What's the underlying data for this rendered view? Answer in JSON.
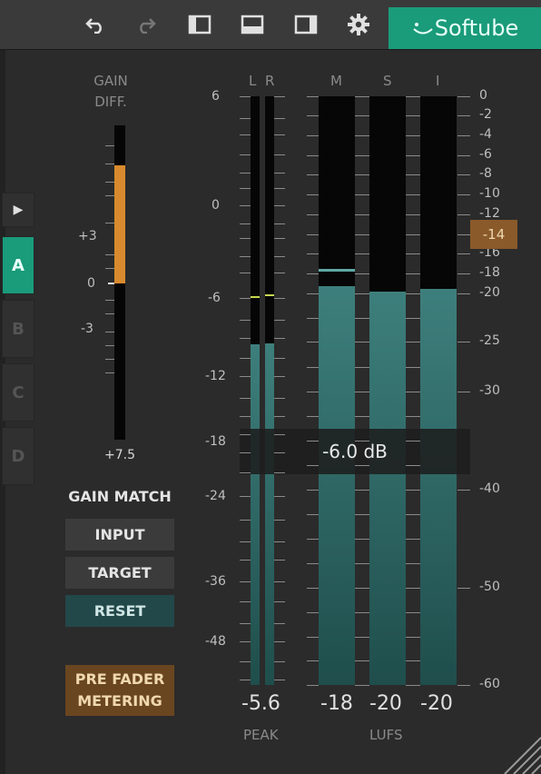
{
  "toolbar": {
    "icons": [
      "undo-icon",
      "redo-icon",
      "layout-left-icon",
      "layout-bottom-icon",
      "layout-right-icon",
      "gear-icon"
    ],
    "brand": "Softube"
  },
  "sidebar": {
    "play": "▶",
    "slots": [
      "A",
      "B",
      "C",
      "D"
    ],
    "active_slot": "A"
  },
  "gain_diff": {
    "label": "GAIN\nDIFF.",
    "scale": [
      "+3",
      "0",
      "-3"
    ],
    "bottom_value": "+7.5",
    "bar_color": "#d98a2e"
  },
  "gain_match": {
    "title": "GAIN MATCH",
    "input": "INPUT",
    "target": "TARGET",
    "reset": "RESET"
  },
  "pre_fader": "PRE FADER\nMETERING",
  "peak": {
    "channels": [
      "L",
      "R"
    ],
    "scale": [
      "6",
      "0",
      "-6",
      "-12",
      "-18",
      "-24",
      "-36",
      "-48"
    ],
    "value": "-5.6",
    "label": "PEAK"
  },
  "lufs": {
    "channels": [
      "M",
      "S",
      "I"
    ],
    "scale": [
      "0",
      "-2",
      "-4",
      "-6",
      "-8",
      "-10",
      "-12",
      "-14",
      "-16",
      "-18",
      "-20",
      "-25",
      "-30",
      "-40",
      "-50",
      "-60"
    ],
    "target_badge": "-14",
    "values": [
      "-18",
      "-20",
      "-20"
    ],
    "label": "LUFS"
  },
  "tooltip": "-6.0 dB",
  "colors": {
    "accent": "#1a9b7a",
    "orange": "#d98a2e",
    "meter": "#3d7f7c"
  }
}
